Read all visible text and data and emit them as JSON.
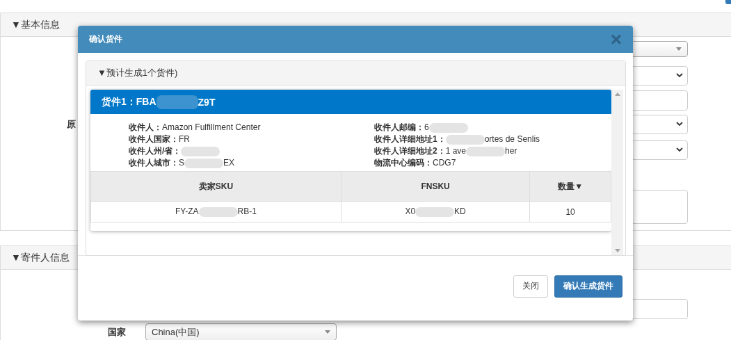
{
  "page": {
    "panels": [
      {
        "title": "▼基本信息",
        "fields": [
          {
            "kind": "combo"
          },
          {
            "kind": "select"
          },
          {
            "kind": "input"
          },
          {
            "kind": "select",
            "label": "原"
          },
          {
            "kind": "select"
          },
          {
            "kind": "textarea"
          }
        ]
      },
      {
        "title": "▼寄件人信息",
        "fields": [
          {
            "kind": "input"
          },
          {
            "kind": "combo",
            "label": "国家",
            "value": "China(中国)"
          }
        ]
      }
    ]
  },
  "dialog": {
    "title": "确认货件",
    "close": "×",
    "group": {
      "title": "▼预计生成1个货件)",
      "shipments": [
        {
          "title": [
            {
              "kind": "text",
              "text": "货件1：FBA"
            },
            {
              "kind": "redacted"
            },
            {
              "kind": "text",
              "text": "Z9T"
            }
          ],
          "info_left": [
            {
              "label": "收件人：",
              "value": [
                {
                  "kind": "text",
                  "text": "Amazon Fulfillment Center"
                }
              ]
            },
            {
              "label": "收件人国家：",
              "value": [
                {
                  "kind": "text",
                  "text": "FR"
                }
              ]
            },
            {
              "label": "收件人州/省：",
              "value": [
                {
                  "kind": "redacted"
                }
              ]
            },
            {
              "label": "收件人城市：",
              "value": [
                {
                  "kind": "text",
                  "text": "S"
                },
                {
                  "kind": "redacted"
                },
                {
                  "kind": "text",
                  "text": "EX"
                }
              ]
            }
          ],
          "info_right": [
            {
              "label": "收件人邮编：",
              "value": [
                {
                  "kind": "text",
                  "text": "6"
                },
                {
                  "kind": "redacted"
                }
              ]
            },
            {
              "label": "收件人详细地址1：",
              "value": [
                {
                  "kind": "redacted"
                },
                {
                  "kind": "text",
                  "text": "ortes de Senlis"
                }
              ]
            },
            {
              "label": "收件人详细地址2：",
              "value": [
                {
                  "kind": "text",
                  "text": "1 ave"
                },
                {
                  "kind": "redacted"
                },
                {
                  "kind": "text",
                  "text": "her"
                }
              ]
            },
            {
              "label": "物流中心编码：",
              "value": [
                {
                  "kind": "text",
                  "text": "CDG7"
                }
              ]
            }
          ],
          "table": {
            "columns": [
              "卖家SKU",
              "FNSKU",
              "数量▼"
            ],
            "rows": [
              [
                [
                  {
                    "kind": "text",
                    "text": "FY-ZA"
                  },
                  {
                    "kind": "redacted"
                  },
                  {
                    "kind": "text",
                    "text": "RB-1"
                  }
                ],
                [
                  {
                    "kind": "text",
                    "text": "X0"
                  },
                  {
                    "kind": "redacted"
                  },
                  {
                    "kind": "text",
                    "text": "KD"
                  }
                ],
                [
                  {
                    "kind": "text",
                    "text": "10"
                  }
                ]
              ]
            ]
          }
        }
      ]
    },
    "buttons": [
      {
        "label": "关闭",
        "kind": "default"
      },
      {
        "label": "确认生成货件",
        "kind": "primary"
      }
    ]
  }
}
